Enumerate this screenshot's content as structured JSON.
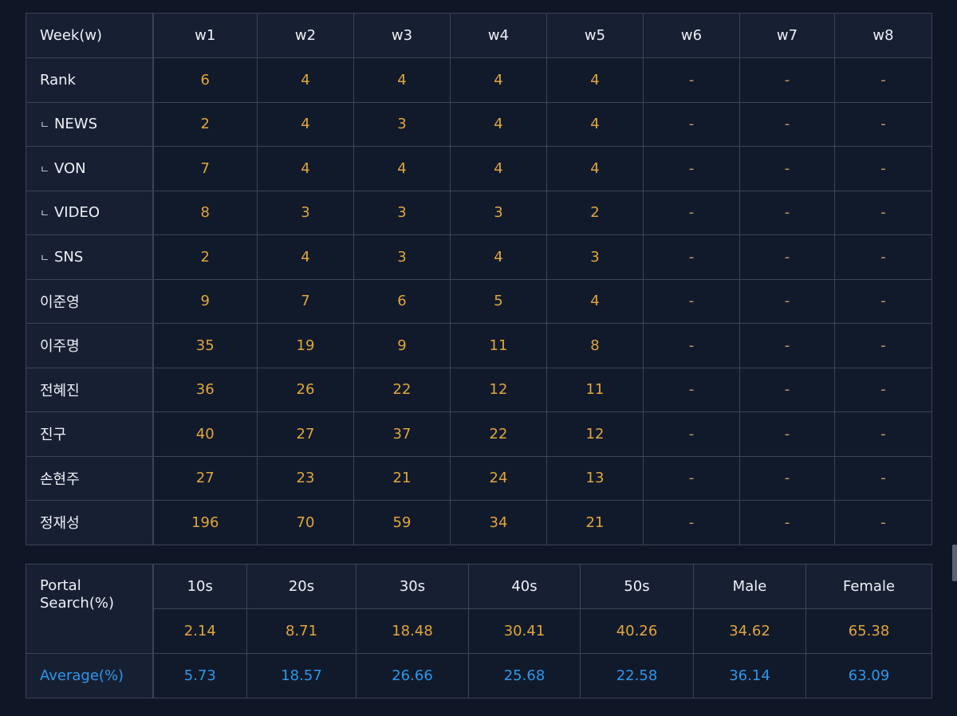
{
  "weekly": {
    "header_label": "Week(w)",
    "weeks": [
      "w1",
      "w2",
      "w3",
      "w4",
      "w5",
      "w6",
      "w7",
      "w8"
    ],
    "sub_marker": "ㄴ",
    "rows": [
      {
        "label": "Rank",
        "sub": false,
        "values": [
          "6",
          "4",
          "4",
          "4",
          "4",
          "-",
          "-",
          "-"
        ]
      },
      {
        "label": "NEWS",
        "sub": true,
        "values": [
          "2",
          "4",
          "3",
          "4",
          "4",
          "-",
          "-",
          "-"
        ]
      },
      {
        "label": "VON",
        "sub": true,
        "values": [
          "7",
          "4",
          "4",
          "4",
          "4",
          "-",
          "-",
          "-"
        ]
      },
      {
        "label": "VIDEO",
        "sub": true,
        "values": [
          "8",
          "3",
          "3",
          "3",
          "2",
          "-",
          "-",
          "-"
        ]
      },
      {
        "label": "SNS",
        "sub": true,
        "values": [
          "2",
          "4",
          "3",
          "4",
          "3",
          "-",
          "-",
          "-"
        ]
      },
      {
        "label": "이준영",
        "sub": false,
        "values": [
          "9",
          "7",
          "6",
          "5",
          "4",
          "-",
          "-",
          "-"
        ]
      },
      {
        "label": "이주명",
        "sub": false,
        "values": [
          "35",
          "19",
          "9",
          "11",
          "8",
          "-",
          "-",
          "-"
        ]
      },
      {
        "label": "전혜진",
        "sub": false,
        "values": [
          "36",
          "26",
          "22",
          "12",
          "11",
          "-",
          "-",
          "-"
        ]
      },
      {
        "label": "진구",
        "sub": false,
        "values": [
          "40",
          "27",
          "37",
          "22",
          "12",
          "-",
          "-",
          "-"
        ]
      },
      {
        "label": "손현주",
        "sub": false,
        "values": [
          "27",
          "23",
          "21",
          "24",
          "13",
          "-",
          "-",
          "-"
        ]
      },
      {
        "label": "정재성",
        "sub": false,
        "values": [
          "196",
          "70",
          "59",
          "34",
          "21",
          "-",
          "-",
          "-"
        ]
      }
    ]
  },
  "demographics": {
    "corner_label_line1": "Portal",
    "corner_label_line2": "Search(%)",
    "columns": [
      "10s",
      "20s",
      "30s",
      "40s",
      "50s",
      "Male",
      "Female"
    ],
    "portal_values": [
      "2.14",
      "8.71",
      "18.48",
      "30.41",
      "40.26",
      "34.62",
      "65.38"
    ],
    "average_label": "Average(%)",
    "average_values": [
      "5.73",
      "18.57",
      "26.66",
      "25.68",
      "22.58",
      "36.14",
      "63.09"
    ]
  },
  "colors": {
    "background": "#0f1726",
    "value_orange": "#e0a53c",
    "average_blue": "#2f96e8",
    "border": "#3a4457"
  }
}
